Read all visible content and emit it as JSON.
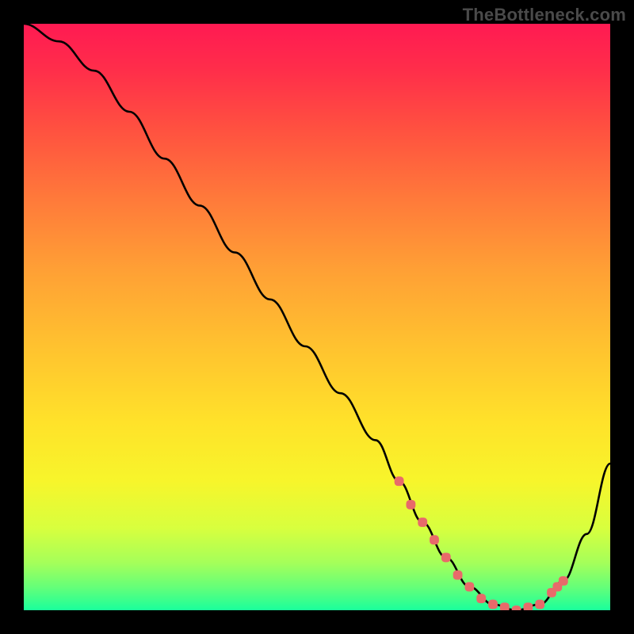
{
  "watermark": "TheBottleneck.com",
  "chart_data": {
    "type": "line",
    "title": "",
    "xlabel": "",
    "ylabel": "",
    "xlim": [
      0,
      100
    ],
    "ylim": [
      0,
      100
    ],
    "x": [
      0,
      6,
      12,
      18,
      24,
      30,
      36,
      42,
      48,
      54,
      60,
      64,
      68,
      72,
      76,
      80,
      84,
      88,
      92,
      96,
      100
    ],
    "bottleneck": [
      100,
      97,
      92,
      85,
      77,
      69,
      61,
      53,
      45,
      37,
      29,
      22,
      15,
      9,
      4,
      1,
      0,
      1,
      5,
      13,
      25
    ],
    "markers_x": [
      64,
      66,
      68,
      70,
      72,
      74,
      76,
      78,
      80,
      82,
      84,
      86,
      88,
      90,
      91,
      92
    ],
    "markers_y": [
      22,
      18,
      15,
      12,
      9,
      6,
      4,
      2,
      1,
      0.5,
      0,
      0.5,
      1,
      3,
      4,
      5
    ],
    "gradient_stops": [
      {
        "pos": 0.0,
        "color": "#ff1a52"
      },
      {
        "pos": 0.08,
        "color": "#ff2e4a"
      },
      {
        "pos": 0.18,
        "color": "#ff5140"
      },
      {
        "pos": 0.3,
        "color": "#ff7a3a"
      },
      {
        "pos": 0.42,
        "color": "#ffa035"
      },
      {
        "pos": 0.55,
        "color": "#ffc22f"
      },
      {
        "pos": 0.68,
        "color": "#ffe22a"
      },
      {
        "pos": 0.78,
        "color": "#f7f52b"
      },
      {
        "pos": 0.86,
        "color": "#d8ff3e"
      },
      {
        "pos": 0.92,
        "color": "#a4ff5a"
      },
      {
        "pos": 0.96,
        "color": "#66ff78"
      },
      {
        "pos": 1.0,
        "color": "#1aff9c"
      }
    ],
    "curve_color": "#000000",
    "marker_color": "#e86a6a"
  }
}
